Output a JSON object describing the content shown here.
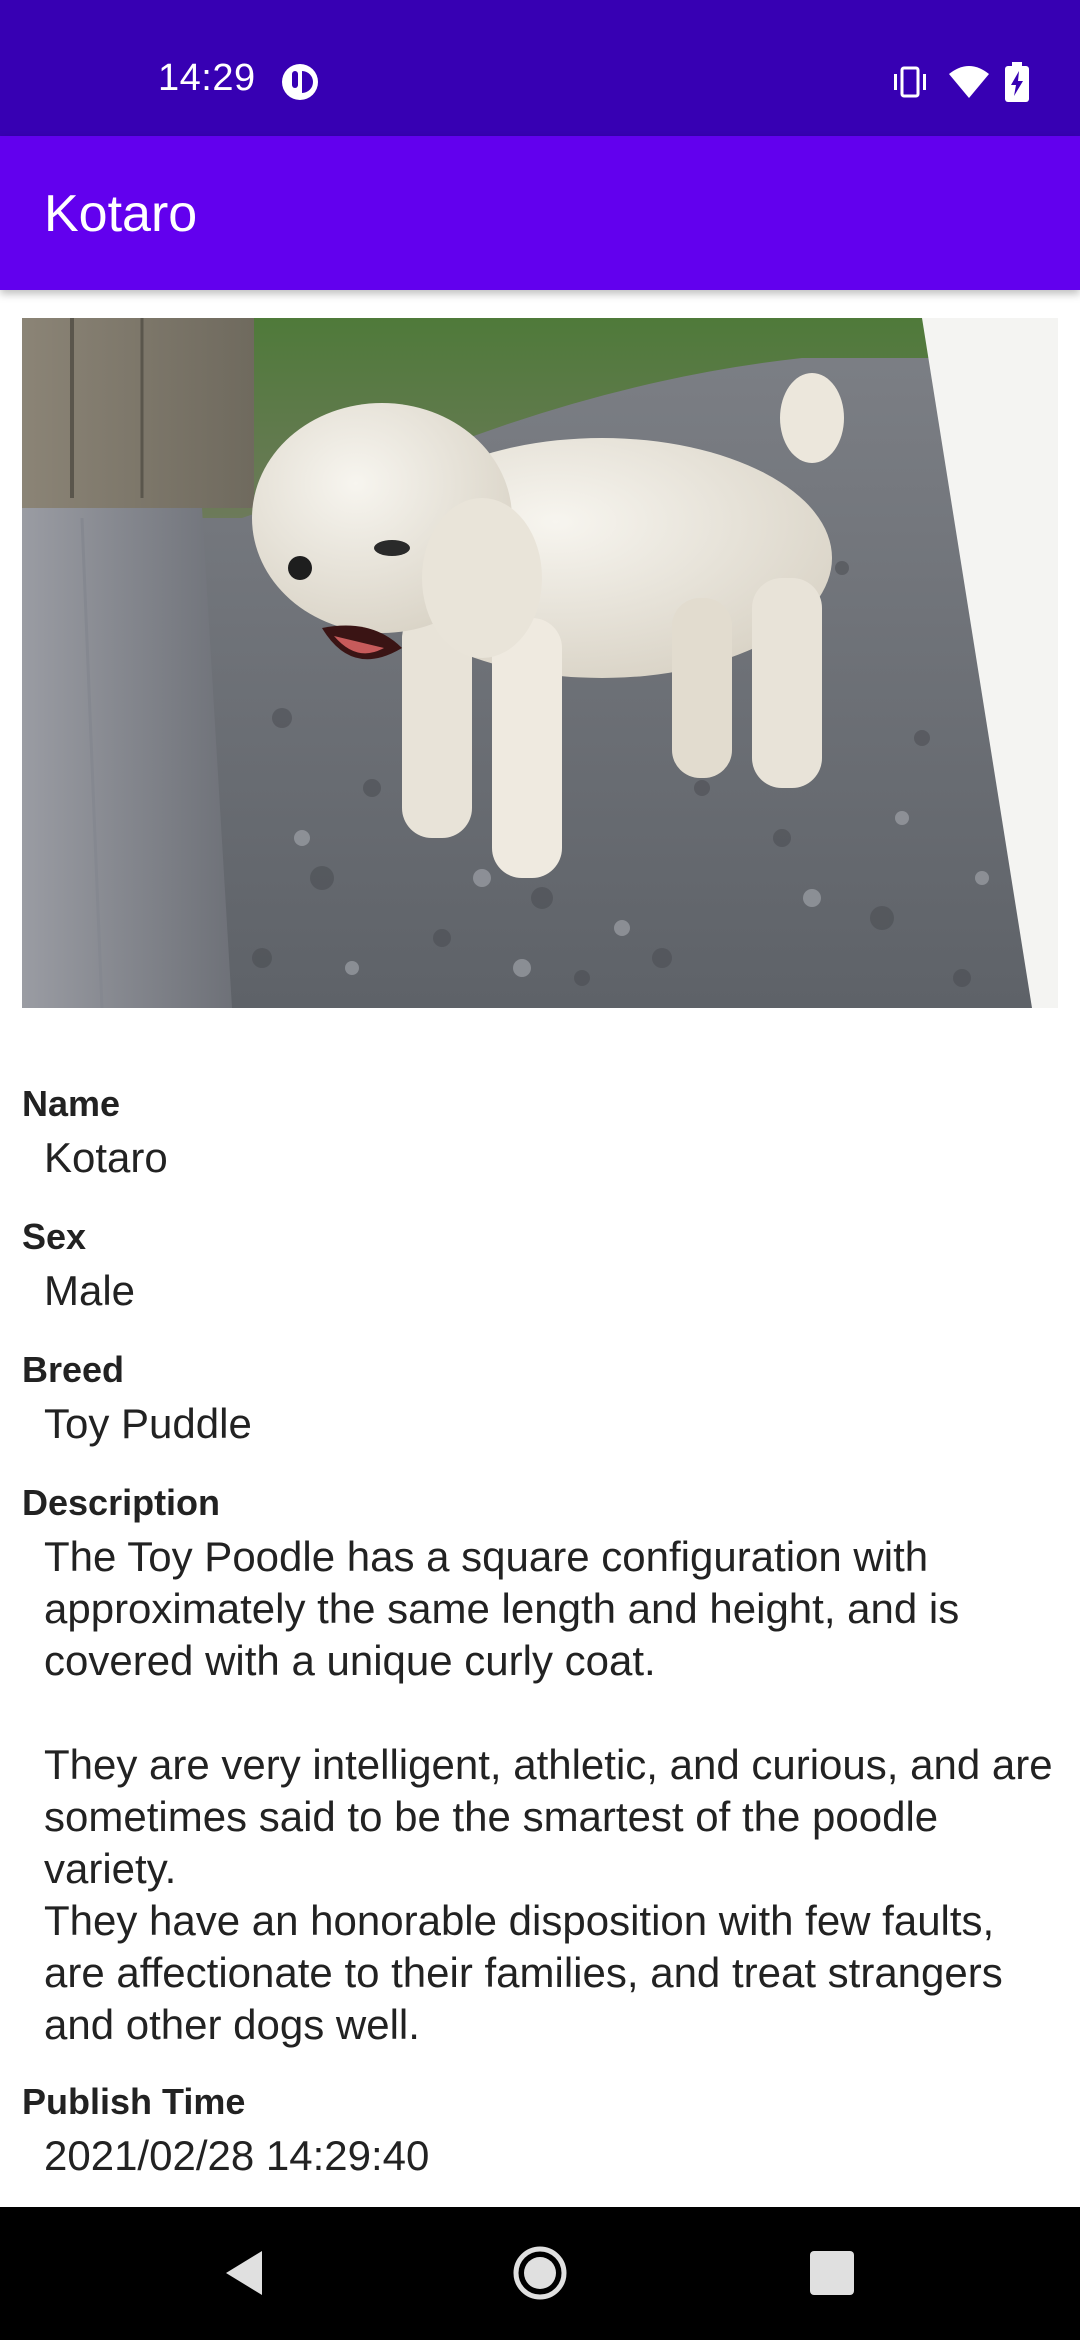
{
  "status_bar": {
    "time": "14:29",
    "icons": [
      "notification-icon",
      "vibrate-icon",
      "wifi-icon",
      "battery-charging-icon"
    ],
    "background": "#3700B3"
  },
  "app_bar": {
    "title": "Kotaro",
    "background": "#6200EE"
  },
  "detail": {
    "image": "dog-photo",
    "name_label": "Name",
    "name_value": "Kotaro",
    "sex_label": "Sex",
    "sex_value": "Male",
    "breed_label": "Breed",
    "breed_value": "Toy Puddle",
    "description_label": "Description",
    "description_p1": "The Toy Poodle has a square configuration with approximately the same length and height, and is covered with a unique curly coat.",
    "description_p2": "They are very intelligent, athletic, and curious, and are sometimes said to be the smartest of the poodle variety.",
    "description_p3": "They have an honorable disposition with few faults, are affectionate to their families, and treat strangers and other dogs well.",
    "publish_label": "Publish Time",
    "publish_value": "2021/02/28 14:29:40"
  },
  "nav_bar": {
    "buttons": [
      "back-icon",
      "home-icon",
      "recents-icon"
    ]
  }
}
